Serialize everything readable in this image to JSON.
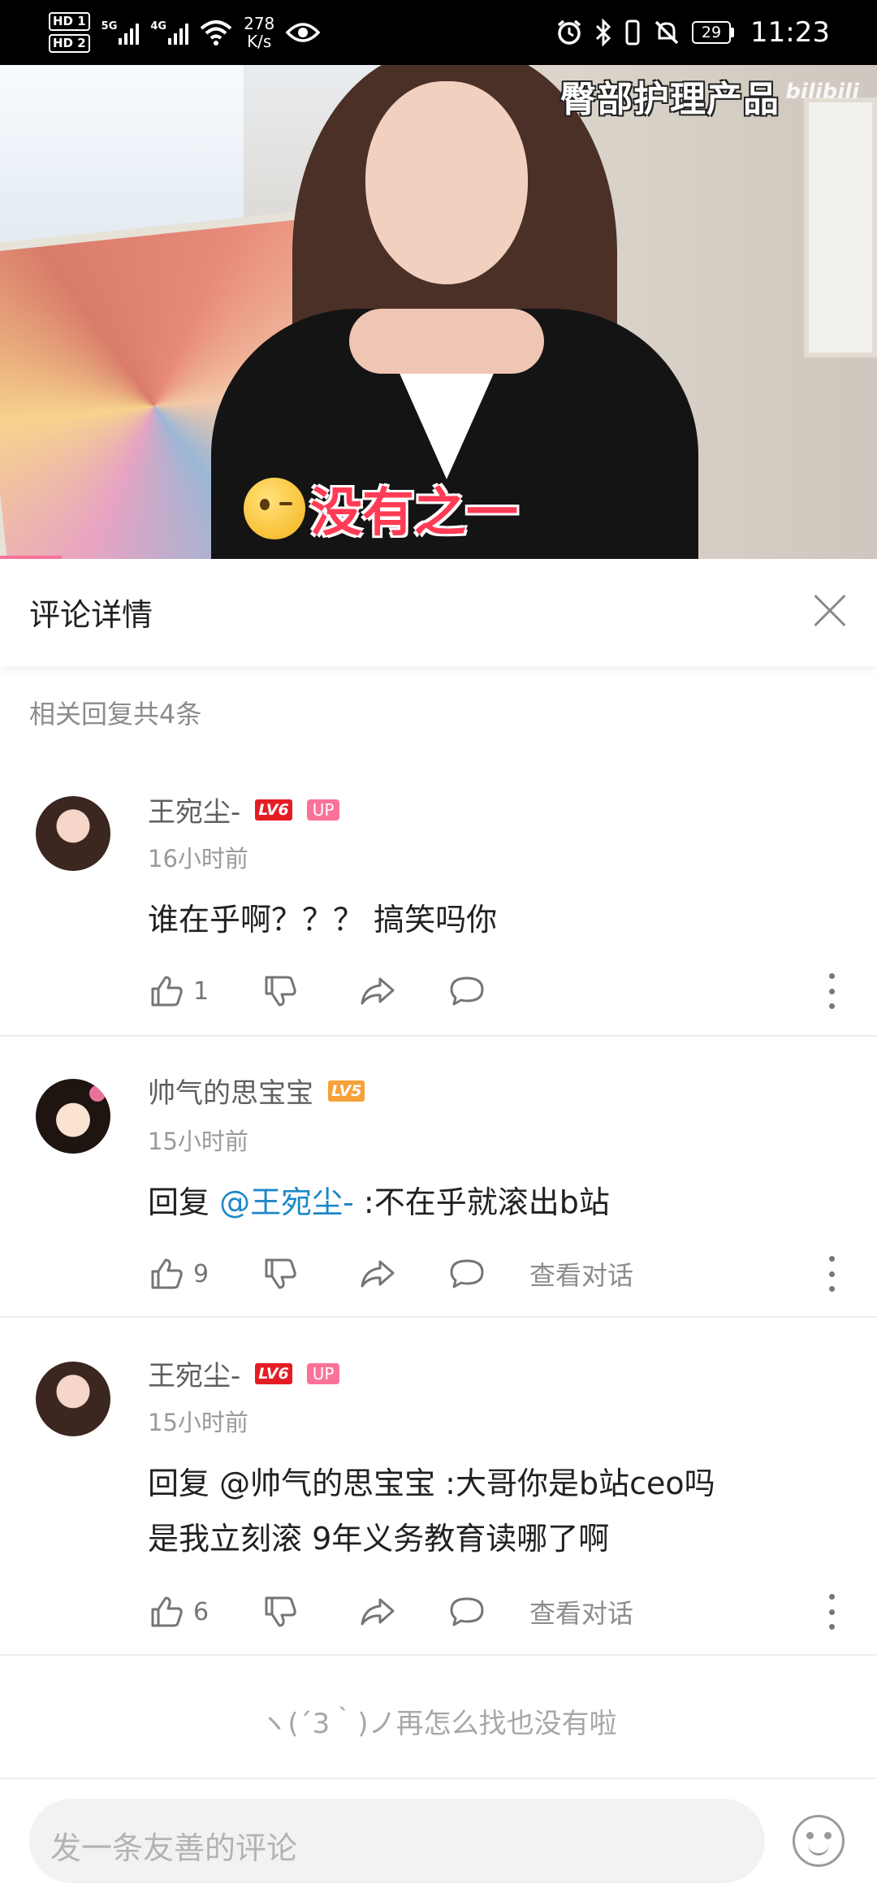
{
  "status_bar": {
    "hd1": "HD 1",
    "hd2": "HD 2",
    "net1": "5G",
    "net2": "4G",
    "speed_value": "278",
    "speed_unit": "K/s",
    "battery": "29",
    "time": "11:23"
  },
  "video": {
    "title_overlay": "臀部护理产品",
    "watermark": "bilibili",
    "caption": "没有之一",
    "progress_fraction": 0.07
  },
  "header": {
    "title": "评论详情"
  },
  "reply_count": "相关回复共4条",
  "comments": [
    {
      "username": "王宛尘-",
      "level": "LV6",
      "up_tag": "UP",
      "time": "16小时前",
      "text": "谁在乎啊？？？ 搞笑吗你",
      "likes": "1",
      "view_conversation": ""
    },
    {
      "username": "帅气的思宝宝",
      "level": "LV5",
      "time": "15小时前",
      "reply_prefix": "回复 ",
      "mention": "@王宛尘-",
      "text": " :不在乎就滚出b站",
      "likes": "9",
      "view_conversation": "查看对话"
    },
    {
      "username": "王宛尘-",
      "level": "LV6",
      "up_tag": "UP",
      "time": "15小时前",
      "text_line1": "回复 @帅气的思宝宝 :大哥你是b站ceo吗",
      "text_line2": "是我立刻滚 9年义务教育读哪了啊",
      "likes": "6",
      "view_conversation": "查看对话"
    }
  ],
  "end_tip": "ヽ(´3｀)ノ再怎么找也没有啦",
  "input": {
    "placeholder": "发一条友善的评论"
  },
  "colors": {
    "accent_pink": "#fb7299",
    "mention_blue": "#1e88c7",
    "level6": "#e51c23",
    "level5": "#f6a13a"
  },
  "icons": [
    "alarm-icon",
    "bluetooth-icon",
    "vibrate-icon",
    "mute-icon",
    "wifi-icon",
    "eye-icon",
    "close-icon",
    "like-icon",
    "dislike-icon",
    "share-icon",
    "reply-icon",
    "more-icon",
    "emoji-icon"
  ]
}
